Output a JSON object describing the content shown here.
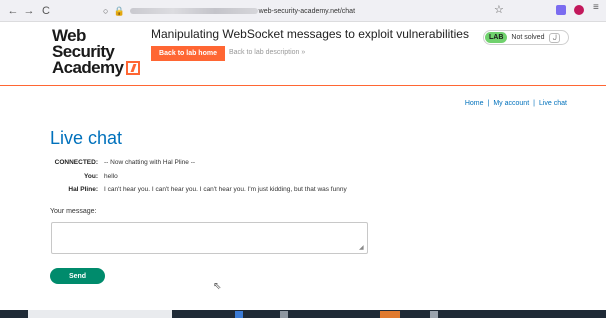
{
  "browser": {
    "back_icon": "←",
    "forward_icon": "→",
    "reload_icon": "C",
    "url_domain": "web-security-academy.net/chat",
    "star_icon": "☆",
    "menu_icon": "≡"
  },
  "header": {
    "logo_line1": "Web Security",
    "logo_line2": "Academy",
    "lab_title": "Manipulating WebSocket messages to exploit vulnerabilities",
    "back_button": "Back to lab home",
    "description_link": "Back to lab description »",
    "lab_badge": "LAB",
    "status": "Not solved",
    "accent_color": "#ff6633"
  },
  "nav": {
    "home": "Home",
    "sep1": "|",
    "account": "My account",
    "sep2": "|",
    "chat": "Live chat",
    "link_color": "#0071bc"
  },
  "chat": {
    "title": "Live chat",
    "messages": [
      {
        "who": "CONNECTED:",
        "text": "-- Now chatting with Hal Pline --"
      },
      {
        "who": "You:",
        "text": "hello"
      },
      {
        "who": "Hal Pline:",
        "text": "I can't hear you. I can't hear you. I can't hear you. I'm just kidding, but that was funny"
      }
    ],
    "message_label": "Your message:",
    "message_value": "",
    "send_button": "Send",
    "send_color": "#008b6c"
  }
}
